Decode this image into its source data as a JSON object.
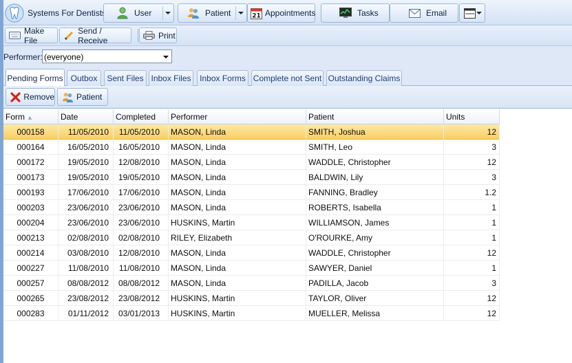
{
  "app": {
    "title": "Systems For Dentists"
  },
  "top_toolbar": {
    "user": {
      "label": "User",
      "icon": "user-icon"
    },
    "patient": {
      "label": "Patient",
      "icon": "patients-icon"
    },
    "appointments": {
      "label": "Appointments",
      "icon": "calendar-icon",
      "calendar_day": "21"
    },
    "tasks": {
      "label": "Tasks",
      "icon": "tasks-monitor-icon"
    },
    "email": {
      "label": "Email",
      "icon": "envelope-icon"
    },
    "layout": {
      "icon": "layout-window-icon"
    }
  },
  "secondary_toolbar": {
    "make_file": "Make File",
    "send_receive": "Send / Receive",
    "print": "Print"
  },
  "performer": {
    "label": "Performer:",
    "value": "(everyone)"
  },
  "tabs": [
    {
      "label": "Pending Forms",
      "active": true
    },
    {
      "label": "Outbox"
    },
    {
      "label": "Sent Files"
    },
    {
      "label": "Inbox Files"
    },
    {
      "label": "Inbox Forms"
    },
    {
      "label": "Complete not Sent"
    },
    {
      "label": "Outstanding Claims"
    }
  ],
  "actions": {
    "remove": "Remove",
    "patient": "Patient"
  },
  "grid": {
    "columns": [
      "Form",
      "Date",
      "Completed",
      "Performer",
      "Patient",
      "Units"
    ],
    "sorted_column": "Form",
    "selected_row": 0,
    "rows": [
      [
        "000158",
        "11/05/2010",
        "11/05/2010",
        "MASON, Linda",
        "SMITH, Joshua",
        "12"
      ],
      [
        "000164",
        "16/05/2010",
        "16/05/2010",
        "MASON, Linda",
        "SMITH, Leo",
        "3"
      ],
      [
        "000172",
        "19/05/2010",
        "12/08/2010",
        "MASON, Linda",
        "WADDLE, Christopher",
        "12"
      ],
      [
        "000173",
        "19/05/2010",
        "19/05/2010",
        "MASON, Linda",
        "BALDWIN, Lily",
        "3"
      ],
      [
        "000193",
        "17/06/2010",
        "17/06/2010",
        "MASON, Linda",
        "FANNING, Bradley",
        "1.2"
      ],
      [
        "000203",
        "23/06/2010",
        "23/06/2010",
        "MASON, Linda",
        "ROBERTS, Isabella",
        "1"
      ],
      [
        "000204",
        "23/06/2010",
        "23/06/2010",
        "HUSKINS, Martin",
        "WILLIAMSON, James",
        "1"
      ],
      [
        "000213",
        "02/08/2010",
        "02/08/2010",
        "RILEY, Elizabeth",
        "O'ROURKE, Amy",
        "1"
      ],
      [
        "000214",
        "03/08/2010",
        "12/08/2010",
        "MASON, Linda",
        "WADDLE, Christopher",
        "12"
      ],
      [
        "000227",
        "11/08/2010",
        "11/08/2010",
        "MASON, Linda",
        "SAWYER, Daniel",
        "1"
      ],
      [
        "000257",
        "08/08/2012",
        "08/08/2012",
        "MASON, Linda",
        "PADILLA, Jacob",
        "3"
      ],
      [
        "000265",
        "23/08/2012",
        "23/08/2012",
        "HUSKINS, Martin",
        "TAYLOR, Oliver",
        "12"
      ],
      [
        "000283",
        "01/11/2012",
        "03/01/2013",
        "HUSKINS, Martin",
        "MUELLER, Melissa",
        "12"
      ]
    ]
  },
  "colors": {
    "selection": "#f9cf62",
    "toolbar": "#d3e2f5",
    "accent_blue": "#1b3e7a"
  }
}
